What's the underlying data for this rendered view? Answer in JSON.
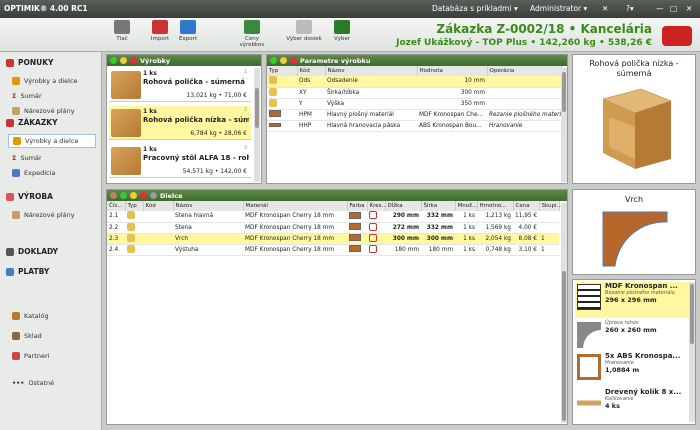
{
  "window": {
    "title": "OPTIMIK® 4.00 RC1",
    "db": "Databáza s príkladmi ▾",
    "user": "Administrator ▾"
  },
  "toolbar": {
    "print": "Tlač",
    "import": "Import",
    "export": "Export",
    "prices": "Ceny výrobkov",
    "select_board": "Výber dosiek",
    "select": "Vyber"
  },
  "order": {
    "title": "Zákazka Z-0002/18 • Kancelária",
    "subtitle": "Jozef Ukážkový - TOP Plus • 142,260 kg • 538,26 €"
  },
  "sidebar": {
    "sections": [
      {
        "label": "PONUKY",
        "items": [
          "Výrobky a dielce",
          "Sumár",
          "Nárezové plány"
        ]
      },
      {
        "label": "ZÁKAZKY",
        "items": [
          "Výrobky a dielce",
          "Sumár",
          "Expedícia"
        ]
      },
      {
        "label": "VÝROBA",
        "items": [
          "Nárezové plány"
        ]
      }
    ],
    "bottom": [
      "DOKLADY",
      "PLATBY"
    ],
    "links": [
      "Katalóg",
      "Sklad",
      "Partneri",
      "Ostatné"
    ]
  },
  "products": {
    "title": "Výrobky",
    "items": [
      {
        "qty": "1 ks",
        "name": "Rohová polička - súmerná",
        "weight": "13,021 kg",
        "price": "71,00 €",
        "idx": "1"
      },
      {
        "qty": "1 ks",
        "name": "Rohová polička nízka - súm...",
        "weight": "6,784 kg",
        "price": "28,06 €",
        "idx": "2"
      },
      {
        "qty": "1 ks",
        "name": "Pracovný stôl ALFA 18 - roh...",
        "weight": "54,571 kg",
        "price": "142,00 €",
        "idx": "3"
      }
    ]
  },
  "params": {
    "title": "Parametre výrobku",
    "headers": [
      "Typ",
      "Kód",
      "Názov",
      "Hodnota",
      "Operácia"
    ],
    "rows": [
      {
        "code": "Ods",
        "name": "Odsadenie",
        "value": "10 mm",
        "op": ""
      },
      {
        "code": "XY",
        "name": "Šírka/hĺbka",
        "value": "300 mm",
        "op": ""
      },
      {
        "code": "Y",
        "name": "Výška",
        "value": "350 mm",
        "op": ""
      },
      {
        "code": "HPM",
        "name": "Hlavný plošný materiál",
        "value": "MDF Kronospan Che...",
        "op": "Rezanie plošného materi..."
      },
      {
        "code": "HHP",
        "name": "Hlavná hranovacia páska",
        "value": "ABS Kronospan Bou...",
        "op": "Hranovanie"
      }
    ]
  },
  "preview": {
    "title": "Rohová polička nízka - súmerná",
    "part_title": "Vrch"
  },
  "parts": {
    "title": "Dielce",
    "headers": [
      "Čís...",
      "Typ",
      "Kód",
      "Názov",
      "Materiál",
      "Farba",
      "Kres...",
      "Dĺžka",
      "Šírka",
      "Množ...",
      "Hmotno...",
      "Cena",
      "Skupi..."
    ],
    "rows": [
      {
        "no": "2.1",
        "name": "Stena hlavná",
        "material": "MDF Kronospan Cherry 18 mm",
        "len": "290 mm",
        "wid": "332 mm",
        "qty": "1 ks",
        "wt": "1,213 kg",
        "price": "11,95 €",
        "grp": ""
      },
      {
        "no": "2.2",
        "name": "Stena",
        "material": "MDF Kronospan Cherry 18 mm",
        "len": "272 mm",
        "wid": "332 mm",
        "qty": "1 ks",
        "wt": "1,569 kg",
        "price": "4,00 €",
        "grp": ""
      },
      {
        "no": "2.3",
        "name": "Vrch",
        "material": "MDF Kronospan Cherry 18 mm",
        "len": "300 mm",
        "wid": "300 mm",
        "qty": "1 ks",
        "wt": "2,054 kg",
        "price": "8,08 €",
        "grp": "1"
      },
      {
        "no": "2.4",
        "name": "Výstuha",
        "material": "MDF Kronospan Cherry 18 mm",
        "len": "180 mm",
        "wid": "180 mm",
        "qty": "1 ks",
        "wt": "0,748 kg",
        "price": "3,10 €",
        "grp": "1"
      }
    ]
  },
  "materials": [
    {
      "name": "MDF Kronospan ...",
      "op": "Rezanie plošného materiálu",
      "dim": "296 x 296 mm"
    },
    {
      "name": "",
      "op": "Úprava rohov",
      "dim": "260 x 260 mm"
    },
    {
      "name": "5x ABS Kronospa...",
      "op": "Hranovanie",
      "dim": "1,0884 m"
    },
    {
      "name": "Drevený kolík 8 x...",
      "op": "Kolíkovanie",
      "dim": "4 ks"
    }
  ]
}
